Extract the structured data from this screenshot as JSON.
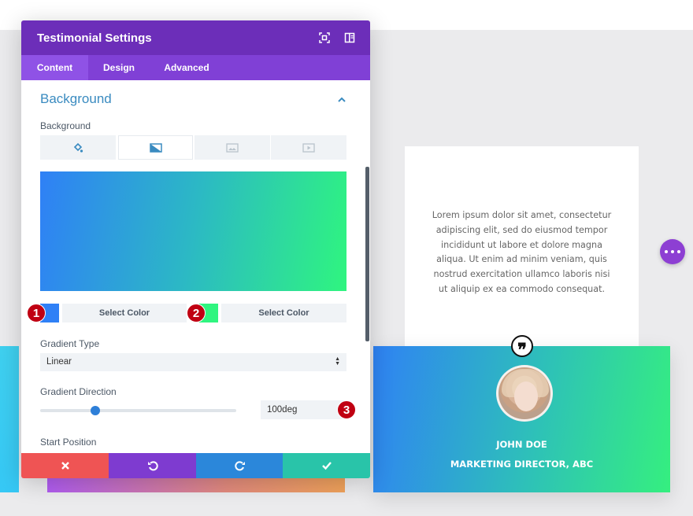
{
  "panel": {
    "title": "Testimonial Settings",
    "tabs": [
      {
        "label": "Content",
        "active": true
      },
      {
        "label": "Design",
        "active": false
      },
      {
        "label": "Advanced",
        "active": false
      }
    ],
    "section_title": "Background",
    "background_label": "Background",
    "background_types": [
      "paint-bucket-icon",
      "gradient-icon",
      "image-icon",
      "video-icon"
    ],
    "gradient": {
      "start_color": "#2f80f6",
      "end_color": "#2ff57f",
      "select_color_1": "Select Color",
      "select_color_2": "Select Color"
    },
    "gradient_type_label": "Gradient Type",
    "gradient_type_value": "Linear",
    "gradient_direction_label": "Gradient Direction",
    "gradient_direction_value": "100deg",
    "gradient_direction_slider": 0.2,
    "start_position_label": "Start Position",
    "actions": {
      "cancel_color": "#ef5454",
      "undo_color": "#7e3bd0",
      "redo_color": "#2b87da",
      "save_color": "#29c4a9"
    }
  },
  "markers": [
    "1",
    "2",
    "3"
  ],
  "testimonial": {
    "body": "Lorem ipsum dolor sit amet, consectetur adipiscing elit, sed do eiusmod tempor incididunt ut labore et dolore magna aliqua. Ut enim ad minim veniam, quis nostrud exercitation ullamco laboris nisi ut aliquip ex ea commodo consequat.",
    "quote_mark": "❞",
    "author": "JOHN DOE",
    "role": "MARKETING DIRECTOR, ABC"
  },
  "colors": {
    "header": "#6c2eb9",
    "tabs": "#8040d6",
    "accent": "#8d3fd3"
  }
}
